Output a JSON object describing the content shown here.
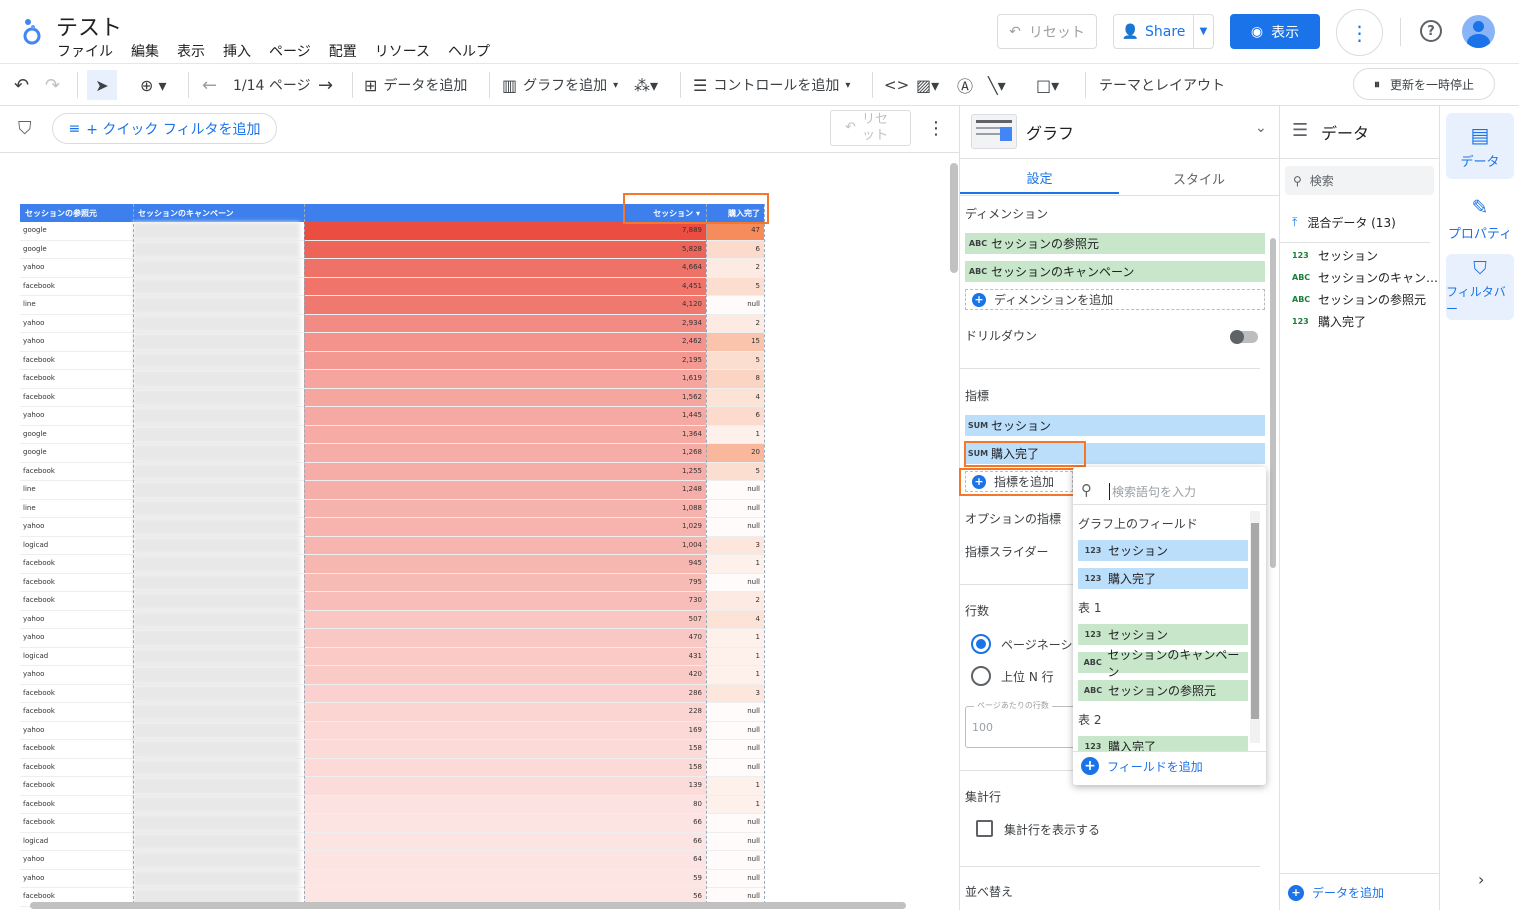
{
  "app": {
    "title": "テスト",
    "menus": [
      "ファイル",
      "編集",
      "表示",
      "挿入",
      "ページ",
      "配置",
      "リソース",
      "ヘルプ"
    ]
  },
  "header": {
    "reset_label": "リセット",
    "share_label": "Share",
    "view_label": "表示"
  },
  "toolbar": {
    "page_label": "1/14 ページ",
    "add_data": "データを追加",
    "add_chart": "グラフを追加",
    "add_control": "コントロールを追加",
    "theme_layout": "テーマとレイアウト",
    "pause_label": "更新を一時停止"
  },
  "filter_bar": {
    "quick_filter": "+ クイック フィルタを追加",
    "reset_label": "リセ ット"
  },
  "table": {
    "headers": [
      "セッションの参照元",
      "セッションのキャンペーン",
      "",
      "セッション ▾",
      "購入完了"
    ],
    "rows": [
      [
        "google",
        "7,889",
        "47"
      ],
      [
        "google",
        "5,828",
        "6"
      ],
      [
        "yahoo",
        "4,664",
        "2"
      ],
      [
        "facebook",
        "4,451",
        "5"
      ],
      [
        "line",
        "4,120",
        "null"
      ],
      [
        "yahoo",
        "2,934",
        "2"
      ],
      [
        "yahoo",
        "2,462",
        "15"
      ],
      [
        "facebook",
        "2,195",
        "5"
      ],
      [
        "facebook",
        "1,619",
        "8"
      ],
      [
        "facebook",
        "1,562",
        "4"
      ],
      [
        "yahoo",
        "1,445",
        "6"
      ],
      [
        "google",
        "1,364",
        "1"
      ],
      [
        "google",
        "1,268",
        "20"
      ],
      [
        "facebook",
        "1,255",
        "5"
      ],
      [
        "line",
        "1,248",
        "null"
      ],
      [
        "line",
        "1,088",
        "null"
      ],
      [
        "yahoo",
        "1,029",
        "null"
      ],
      [
        "logicad",
        "1,004",
        "3"
      ],
      [
        "facebook",
        "945",
        "1"
      ],
      [
        "facebook",
        "795",
        "null"
      ],
      [
        "facebook",
        "730",
        "2"
      ],
      [
        "yahoo",
        "507",
        "4"
      ],
      [
        "yahoo",
        "470",
        "1"
      ],
      [
        "logicad",
        "431",
        "1"
      ],
      [
        "yahoo",
        "420",
        "1"
      ],
      [
        "facebook",
        "286",
        "3"
      ],
      [
        "facebook",
        "228",
        "null"
      ],
      [
        "yahoo",
        "169",
        "null"
      ],
      [
        "facebook",
        "158",
        "null"
      ],
      [
        "facebook",
        "158",
        "null"
      ],
      [
        "facebook",
        "139",
        "1"
      ],
      [
        "facebook",
        "80",
        "1"
      ],
      [
        "facebook",
        "66",
        "null"
      ],
      [
        "logicad",
        "66",
        "null"
      ],
      [
        "yahoo",
        "64",
        "null"
      ],
      [
        "yahoo",
        "59",
        "null"
      ],
      [
        "facebook",
        "56",
        "null"
      ]
    ]
  },
  "graph_panel": {
    "title": "グラフ",
    "tab_setup": "設定",
    "tab_style": "スタイル",
    "dimension_label": "ディメンション",
    "dimensions": [
      {
        "tag": "ABC",
        "name": "セッションの参照元"
      },
      {
        "tag": "ABC",
        "name": "セッションのキャンペーン"
      }
    ],
    "add_dimension": "ディメンションを追加",
    "drilldown": "ドリルダウン",
    "metric_label": "指標",
    "metrics": [
      {
        "tag": "SUM",
        "name": "セッション"
      },
      {
        "tag": "SUM",
        "name": "購入完了"
      }
    ],
    "add_metric": "指標を追加",
    "optional_metrics": "オプションの指標",
    "metric_slider": "指標スライダー",
    "rows_label": "行数",
    "pagination": "ページネーション",
    "top_n": "上位 N 行",
    "per_page_label": "ページあたりの行数",
    "per_page_value": "100",
    "summary_label": "集計行",
    "summary_checkbox": "集計行を表示する",
    "sort_label": "並べ替え"
  },
  "popup": {
    "search_placeholder": "検索語句を入力",
    "section_chart": "グラフ上のフィールド",
    "chart_fields": [
      {
        "tag": "123",
        "name": "セッション"
      },
      {
        "tag": "123",
        "name": "購入完了"
      }
    ],
    "section_t1": "表 1",
    "t1_fields": [
      {
        "tag": "123",
        "name": "セッション"
      },
      {
        "tag": "ABC",
        "name": "セッションのキャンペーン"
      },
      {
        "tag": "ABC",
        "name": "セッションの参照元"
      }
    ],
    "section_t2": "表 2",
    "t2_fields": [
      {
        "tag": "123",
        "name": "購入完了"
      }
    ],
    "add_field": "フィールドを追加"
  },
  "data_panel": {
    "title": "データ",
    "search_placeholder": "検索",
    "source": "混合データ (13)",
    "fields": [
      {
        "tag": "123",
        "name": "セッション"
      },
      {
        "tag": "ABC",
        "name": "セッションのキャン…"
      },
      {
        "tag": "ABC",
        "name": "セッションの参照元"
      },
      {
        "tag": "123",
        "name": "購入完了"
      }
    ],
    "add_data": "データを追加"
  },
  "right_rail": {
    "data": "データ",
    "properties": "プロパティ",
    "filter": "フィルタバー"
  },
  "colors": {
    "accent": "#1a73e8",
    "header_blue": "#3d80ed",
    "highlight": "#f5782a",
    "dim_green": "#c8e6c9",
    "metric_blue": "#bbdefb"
  }
}
